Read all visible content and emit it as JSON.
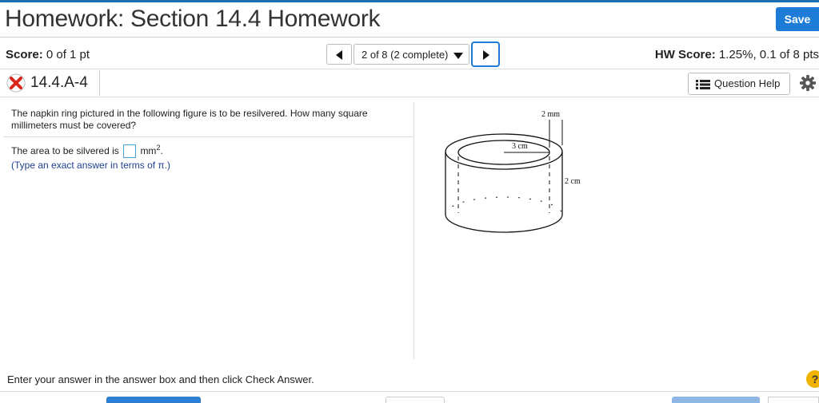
{
  "header": {
    "title": "Homework: Section 14.4 Homework",
    "save_label": "Save"
  },
  "score": {
    "label": "Score:",
    "value": "0 of 1 pt"
  },
  "nav": {
    "position_label": "2 of 8 (2 complete)"
  },
  "hw_score": {
    "label": "HW Score:",
    "value": "1.25%, 0.1 of 8 pts"
  },
  "question_tab": {
    "id": "14.4.A-4",
    "status": "incorrect"
  },
  "question_help": {
    "label": "Question Help"
  },
  "question": {
    "text": "The napkin ring pictured in the following figure is to be resilvered. How many square millimeters must be covered?",
    "answer_prefix": "The area to be silvered is",
    "unit": "mm",
    "unit_power": "2",
    "suffix": ".",
    "hint": "(Type an exact answer in terms of π.)"
  },
  "figure": {
    "label_thickness": "2 mm",
    "label_diameter": "3 cm",
    "label_height": "2 cm"
  },
  "footer": {
    "instruction": "Enter your answer in the answer box and then click Check Answer.",
    "help_glyph": "?"
  },
  "colors": {
    "accent": "#1d7cd6",
    "incorrect": "#d9261c",
    "hint_text": "#1f3f91",
    "help_badge": "#f0b400"
  }
}
